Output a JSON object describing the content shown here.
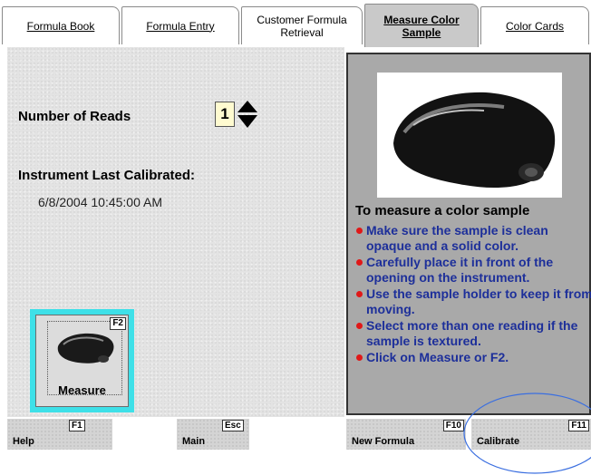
{
  "tabs": [
    {
      "label": "Formula Book",
      "active": false
    },
    {
      "label": "Formula Entry",
      "active": false
    },
    {
      "label": "Customer Formula\nRetrieval",
      "active": false
    },
    {
      "label": "Measure Color\nSample",
      "active": true
    },
    {
      "label": "Color Cards",
      "active": false
    }
  ],
  "left": {
    "reads_label": "Number of Reads",
    "reads_value": "1",
    "calibrated_label": "Instrument Last Calibrated:",
    "calibrated_value": "6/8/2004  10:45:00 AM",
    "measure_button": {
      "label": "Measure",
      "key": "F2",
      "icon": "spectrophotometer-icon"
    }
  },
  "instructions": {
    "title": "To measure a color sample",
    "items": [
      "Make sure the sample is clean opaque and a solid color.",
      "Carefully place it in front of the opening on the instrument.",
      "Use the sample holder to keep it from moving.",
      "Select more than one reading if the sample is textured.",
      "Click on Measure or F2."
    ]
  },
  "bottom": [
    {
      "label": "Help",
      "key": "F1"
    },
    {
      "label": "Main",
      "key": "Esc"
    },
    {
      "label": "New Formula",
      "key": "F10"
    },
    {
      "label": "Calibrate",
      "key": "F11"
    }
  ],
  "colors": {
    "accent_cyan": "#3ee0e8",
    "instruction_text": "#1d2f9a",
    "bullet": "#e01818",
    "panel": "#a9a9a9"
  }
}
